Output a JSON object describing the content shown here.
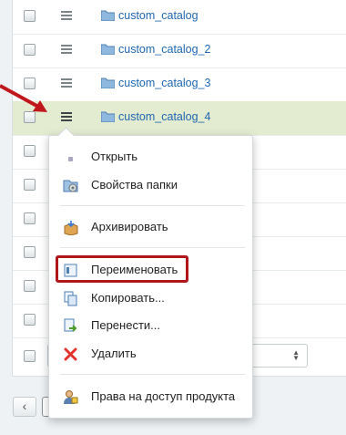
{
  "rows": [
    {
      "name": "custom_catalog",
      "selected": false
    },
    {
      "name": "custom_catalog_2",
      "selected": false
    },
    {
      "name": "custom_catalog_3",
      "selected": false
    },
    {
      "name": "custom_catalog_4",
      "selected": true
    },
    {
      "name": "",
      "selected": false
    },
    {
      "name": "",
      "selected": false
    },
    {
      "name": "",
      "selected": false
    },
    {
      "name": "",
      "selected": false
    },
    {
      "name": "",
      "selected": false
    },
    {
      "name": "",
      "selected": false
    }
  ],
  "context_menu": {
    "items": [
      {
        "label": "Открыть",
        "icon": "dot-icon"
      },
      {
        "label": "Свойства папки",
        "icon": "folder-properties-icon"
      },
      {
        "label": "Архивировать",
        "icon": "archive-box-icon"
      },
      {
        "label": "Переименовать",
        "icon": "rename-icon",
        "highlighted": true
      },
      {
        "label": "Копировать...",
        "icon": "copy-icon"
      },
      {
        "label": "Перенести...",
        "icon": "move-icon"
      },
      {
        "label": "Удалить",
        "icon": "delete-icon"
      },
      {
        "label": "Права на доступ продукта",
        "icon": "access-rights-icon"
      }
    ]
  },
  "pager": {
    "prev_label": "‹"
  },
  "colors": {
    "selected_row": "#e3ebd0",
    "link": "#2067b0",
    "highlight_border": "#b0161b",
    "arrow": "#c0171c"
  }
}
